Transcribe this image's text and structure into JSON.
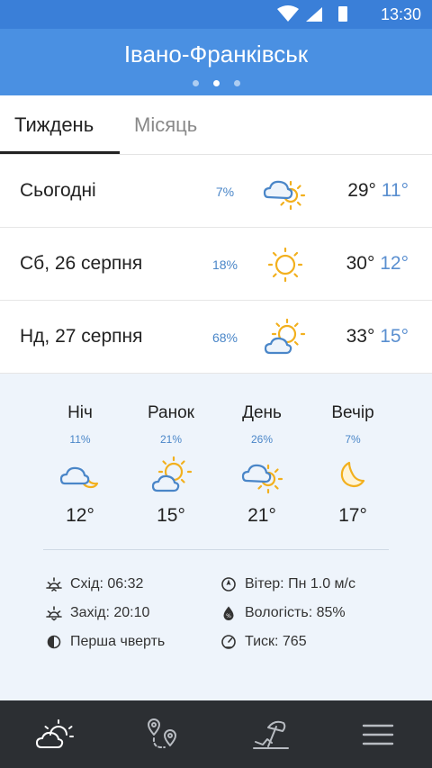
{
  "status_bar": {
    "time": "13:30"
  },
  "header": {
    "city": "Івано-Франківськ",
    "page_count": 3,
    "active_page": 2
  },
  "tabs": {
    "week": "Тиждень",
    "month": "Місяць",
    "active": "week"
  },
  "days": [
    {
      "name": "Сьогодні",
      "precip": "7%",
      "icon": "cloud-sun-icon",
      "max": "29°",
      "min": "11°"
    },
    {
      "name": "Сб, 26 серпня",
      "precip": "18%",
      "icon": "sun-icon",
      "max": "30°",
      "min": "12°"
    },
    {
      "name": "Нд, 27 серпня",
      "precip": "68%",
      "icon": "sun-cloud-icon",
      "max": "33°",
      "min": "15°"
    }
  ],
  "periods": [
    {
      "name": "Ніч",
      "precip": "11%",
      "icon": "cloud-moon-icon",
      "temp": "12°"
    },
    {
      "name": "Ранок",
      "precip": "21%",
      "icon": "sun-cloud-icon",
      "temp": "15°"
    },
    {
      "name": "День",
      "precip": "26%",
      "icon": "cloud-sun-icon",
      "temp": "21°"
    },
    {
      "name": "Вечір",
      "precip": "7%",
      "icon": "moon-icon",
      "temp": "17°"
    }
  ],
  "details": {
    "sunrise": "Схід: 06:32",
    "sunset": "Захід: 20:10",
    "moon_phase": "Перша чверть",
    "wind": "Вітер: Пн 1.0 м/с",
    "humidity": "Вологість: 85%",
    "pressure": "Тиск: 765"
  },
  "colors": {
    "status_bar": "#3a7fd8",
    "header": "#4a90e2",
    "accent_blue": "#5a8fd0",
    "sun_yellow": "#f2b01e",
    "cloud_blue": "#4a86c8",
    "panel_bg": "#eef4fb",
    "nav_bg": "#2c2f33"
  },
  "bottom_nav": [
    {
      "icon": "weather-icon"
    },
    {
      "icon": "locations-icon"
    },
    {
      "icon": "beach-icon"
    },
    {
      "icon": "menu-icon"
    }
  ]
}
